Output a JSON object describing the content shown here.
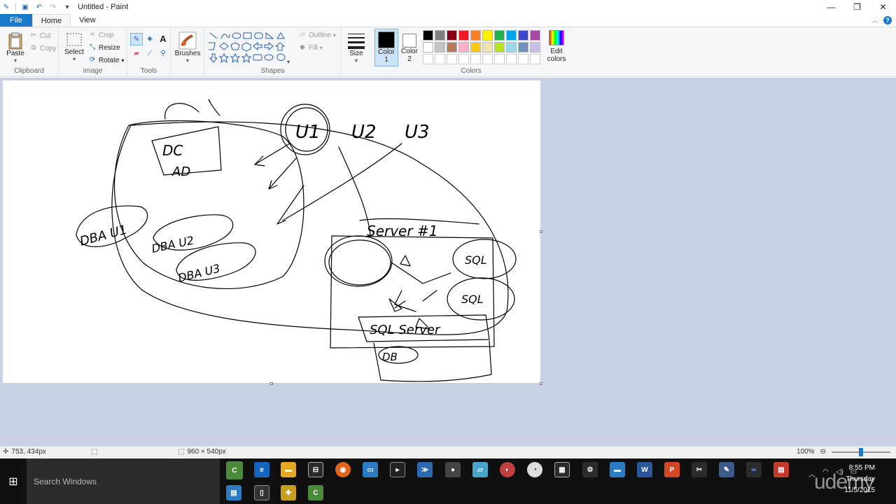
{
  "window": {
    "title": "Untitled - Paint"
  },
  "tabs": {
    "file": "File",
    "home": "Home",
    "view": "View"
  },
  "clipboard": {
    "paste": "Paste",
    "cut": "Cut",
    "copy": "Copy",
    "group": "Clipboard"
  },
  "image": {
    "select": "Select",
    "crop": "Crop",
    "resize": "Resize",
    "rotate": "Rotate",
    "group": "Image"
  },
  "tools": {
    "group": "Tools",
    "text_tool": "A"
  },
  "brushes": {
    "label": "Brushes"
  },
  "shapes": {
    "group": "Shapes",
    "outline": "Outline",
    "fill": "Fill"
  },
  "size": {
    "label": "Size"
  },
  "color1": {
    "label": "Color",
    "num": "1",
    "value": "#000000"
  },
  "color2": {
    "label": "Color",
    "num": "2",
    "value": "#ffffff"
  },
  "colors": {
    "group": "Colors",
    "edit": "Edit colors",
    "row1": [
      "#000000",
      "#7f7f7f",
      "#880015",
      "#ed1c24",
      "#ff7f27",
      "#fff200",
      "#22b14c",
      "#00a2e8",
      "#3f48cc",
      "#a349a4"
    ],
    "row2": [
      "#ffffff",
      "#c3c3c3",
      "#b97a57",
      "#ffaec9",
      "#ffc90e",
      "#efe4b0",
      "#b5e61d",
      "#99d9ea",
      "#7092be",
      "#c8bfe7"
    ]
  },
  "drawing": {
    "labels": [
      "DC",
      "AD",
      "U1",
      "U2",
      "U3",
      "DBA U1",
      "DBA U2",
      "DBA U3",
      "Server #1",
      "SQL",
      "DB",
      "SQL Server"
    ]
  },
  "statusbar": {
    "cursor_pos": "753, 434px",
    "canvas_size": "960 × 540px",
    "zoom": "100%",
    "zoom_level": 0.5
  },
  "taskbar": {
    "search_placeholder": "Search Windows",
    "time": "8:55 PM",
    "day": "Thursday",
    "date": "11/5/2015",
    "watermark": "udemy"
  }
}
